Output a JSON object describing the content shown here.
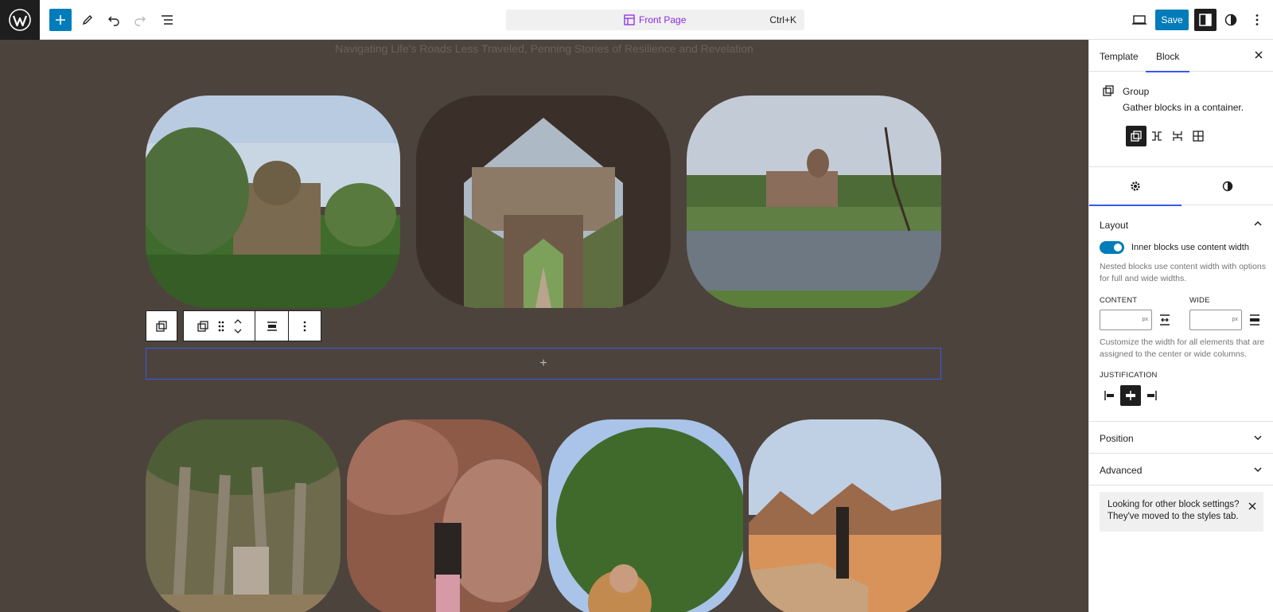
{
  "topbar": {
    "document_title": "Front Page",
    "shortcut": "Ctrl+K",
    "save_label": "Save"
  },
  "canvas": {
    "tagline": "Navigating Life's Roads Less Traveled, Penning Stories of Resilience and Revelation",
    "appender_symbol": "+"
  },
  "sidebar": {
    "tabs": [
      {
        "label": "Template"
      },
      {
        "label": "Block"
      }
    ],
    "block": {
      "title": "Group",
      "description": "Gather blocks in a container."
    },
    "layout": {
      "title": "Layout",
      "toggle_label": "Inner blocks use content width",
      "toggle_help": "Nested blocks use content width with options for full and wide widths.",
      "content_label": "CONTENT",
      "wide_label": "WIDE",
      "unit": "px",
      "width_help": "Customize the width for all elements that are assigned to the center or wide columns.",
      "justification_label": "JUSTIFICATION"
    },
    "position_title": "Position",
    "advanced_title": "Advanced",
    "notice": "Looking for other block settings? They've moved to the styles tab."
  }
}
